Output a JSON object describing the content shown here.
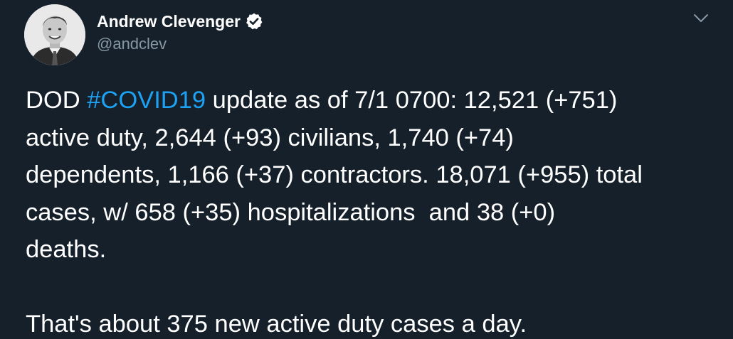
{
  "author": {
    "display_name": "Andrew Clevenger",
    "handle": "@andclev",
    "verified": true,
    "avatar_icon": "profile-photo"
  },
  "menu": {
    "icon": "chevron-down-icon"
  },
  "tweet": {
    "line1_prefix": "DOD ",
    "hashtag": "#COVID19",
    "line1_suffix": " update as of 7/1 0700: 12,521 (+751)",
    "line2": "active duty, 2,644 (+93) civilians, 1,740 (+74)",
    "line3": "dependents, 1,166 (+37) contractors. 18,071 (+955) total",
    "line4": "cases, w/ 658 (+35) hospitalizations  and 38 (+0)",
    "line5": "deaths.",
    "line6": "That's about 375 new active duty cases a day."
  },
  "colors": {
    "background": "#15202b",
    "text": "#ffffff",
    "secondary_text": "#8899a6",
    "hashtag": "#1da1f2"
  }
}
